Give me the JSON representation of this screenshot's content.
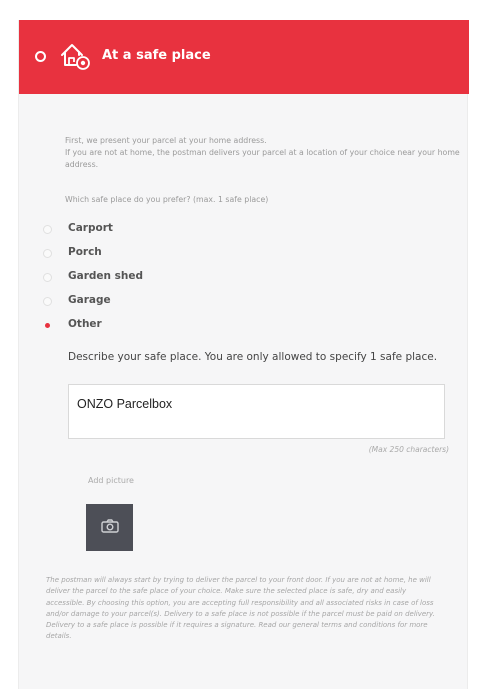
{
  "header": {
    "title": "At a safe place",
    "icon": "home-safe-place-icon",
    "color": "#e8323f"
  },
  "intro": {
    "line1": "First, we present your parcel at your home address.",
    "line2": "If you are not at home, the postman delivers your parcel at a location of your choice near your home address."
  },
  "question": "Which safe place do you prefer? (max. 1 safe place)",
  "options": [
    {
      "label": "Carport",
      "selected": false
    },
    {
      "label": "Porch",
      "selected": false
    },
    {
      "label": "Garden shed",
      "selected": false
    },
    {
      "label": "Garage",
      "selected": false
    },
    {
      "label": "Other",
      "selected": true
    }
  ],
  "describe_label": "Describe your safe place. You are only allowed to specify 1 safe place.",
  "textarea_value": "ONZO Parcelbox",
  "max_chars_label": "(Max 250 characters)",
  "add_picture_label": "Add picture",
  "camera_icon": "camera-icon",
  "disclaimer": "The postman will always start by trying to deliver the parcel to your front door. If you are not at home, he will deliver the parcel to the safe place of your choice. Make sure the selected place is safe, dry and easily accessible. By choosing this option, you are accepting full responsibility and all associated risks in case of loss and/or damage to your parcel(s). Delivery to a safe place is not possible if the parcel must be paid on delivery. Delivery to a safe place is possible if it requires a signature. Read our general terms and conditions for more details."
}
